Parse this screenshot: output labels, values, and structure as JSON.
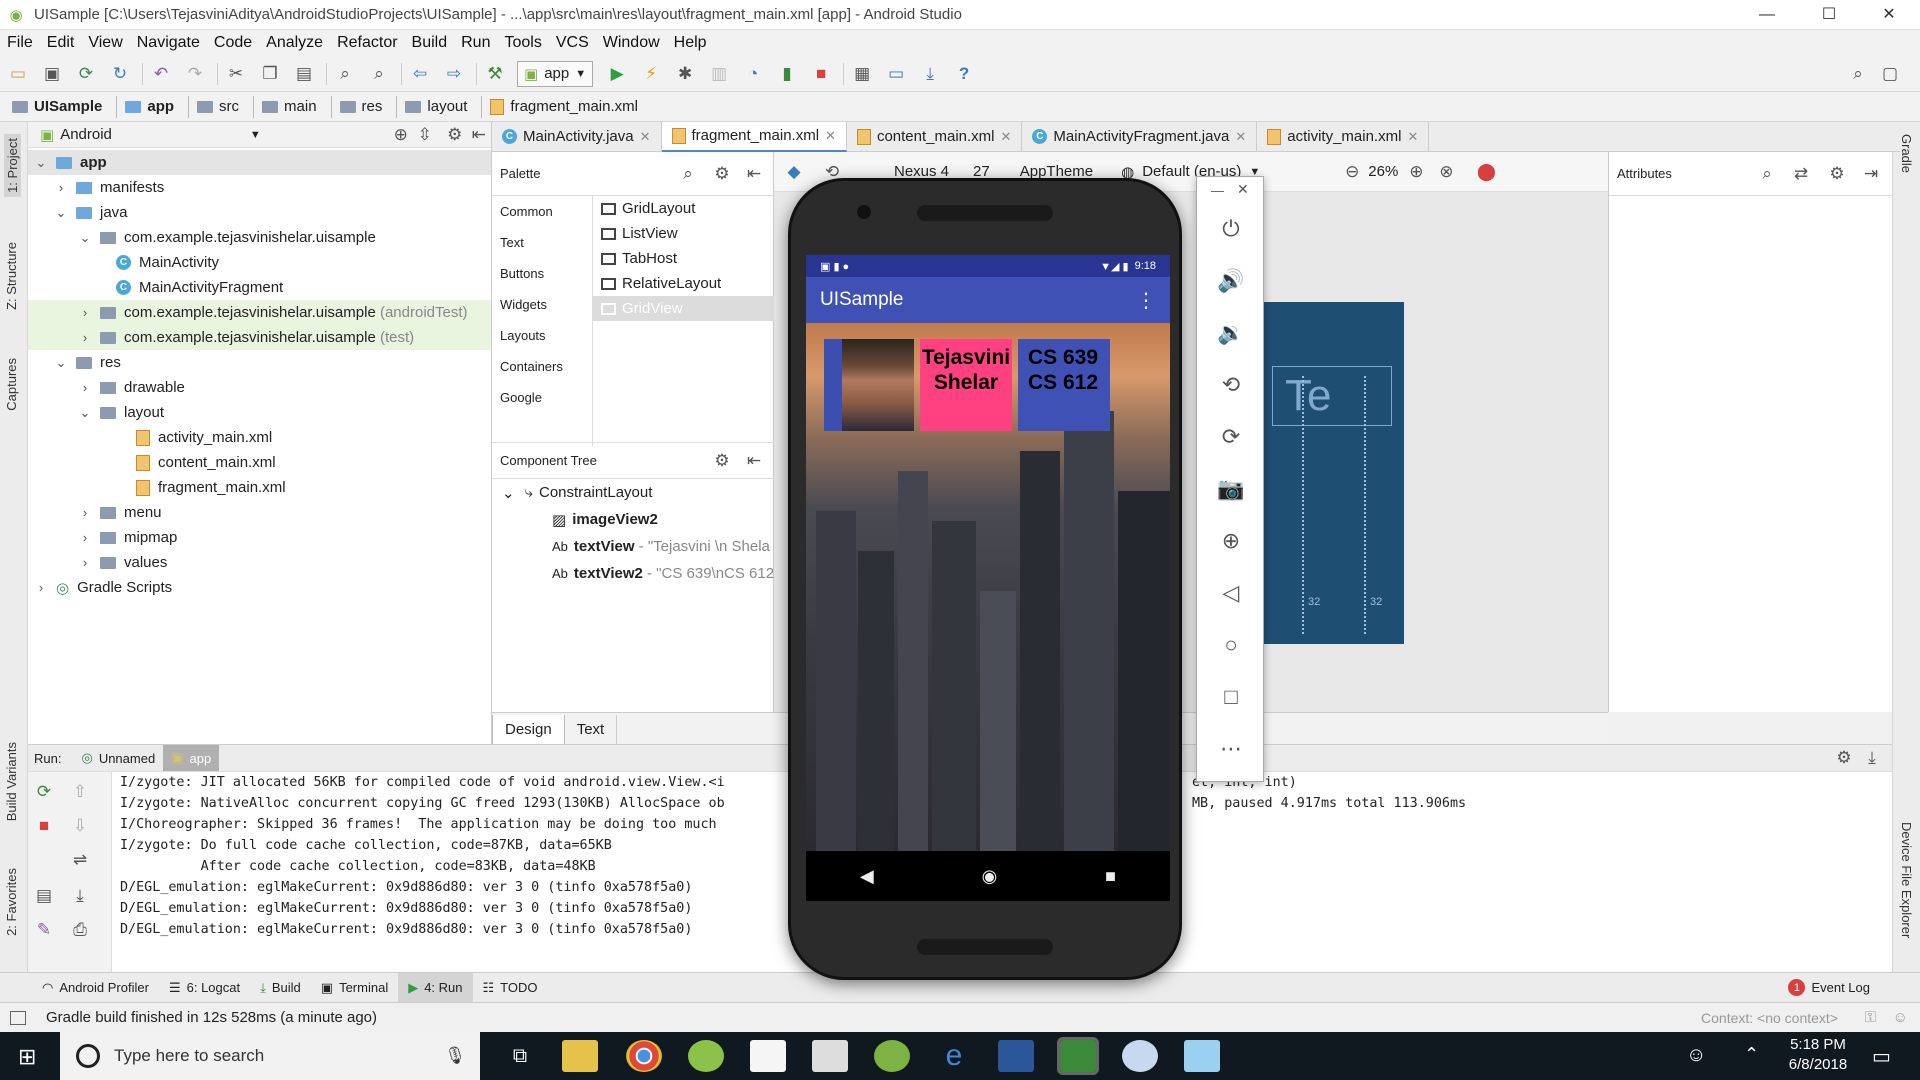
{
  "window": {
    "title": "UISample [C:\\Users\\TejasviniAditya\\AndroidStudioProjects\\UISample] - ...\\app\\src\\main\\res\\layout\\fragment_main.xml [app] - Android Studio",
    "minimize": "—",
    "maximize": "☐",
    "close": "✕"
  },
  "menu": [
    "File",
    "Edit",
    "View",
    "Navigate",
    "Code",
    "Analyze",
    "Refactor",
    "Build",
    "Run",
    "Tools",
    "VCS",
    "Window",
    "Help"
  ],
  "toolbar": {
    "run_config": "app",
    "help": "?"
  },
  "breadcrumb": [
    "UISample",
    "app",
    "src",
    "main",
    "res",
    "layout",
    "fragment_main.xml"
  ],
  "left_strip": {
    "project": "1: Project",
    "structure": "Z: Structure",
    "captures": "Captures",
    "build_variants": "Build Variants",
    "favorites": "2: Favorites"
  },
  "right_strip": {
    "gradle": "Gradle",
    "device_file_explorer": "Device File Explorer"
  },
  "project_panel": {
    "view_mode": "Android",
    "tree": [
      {
        "label": "app",
        "bold": true
      },
      {
        "label": "manifests"
      },
      {
        "label": "java"
      },
      {
        "label": "com.example.tejasvinishelar.uisample"
      },
      {
        "label": "MainActivity"
      },
      {
        "label": "MainActivityFragment"
      },
      {
        "label": "com.example.tejasvinishelar.uisample",
        "suffix": "(androidTest)"
      },
      {
        "label": "com.example.tejasvinishelar.uisample",
        "suffix": "(test)"
      },
      {
        "label": "res"
      },
      {
        "label": "drawable"
      },
      {
        "label": "layout"
      },
      {
        "label": "activity_main.xml"
      },
      {
        "label": "content_main.xml"
      },
      {
        "label": "fragment_main.xml"
      },
      {
        "label": "menu"
      },
      {
        "label": "mipmap"
      },
      {
        "label": "values"
      },
      {
        "label": "Gradle Scripts"
      }
    ]
  },
  "editor_tabs": [
    {
      "label": "MainActivity.java"
    },
    {
      "label": "fragment_main.xml",
      "active": true
    },
    {
      "label": "content_main.xml"
    },
    {
      "label": "MainActivityFragment.java"
    },
    {
      "label": "activity_main.xml"
    }
  ],
  "palette": {
    "title": "Palette",
    "categories": [
      "Common",
      "Text",
      "Buttons",
      "Widgets",
      "Layouts",
      "Containers",
      "Google"
    ],
    "items": [
      "GridLayout",
      "ListView",
      "TabHost",
      "RelativeLayout",
      "GridView"
    ]
  },
  "component_tree": {
    "title": "Component Tree",
    "root": "ConstraintLayout",
    "children": [
      {
        "name": "imageView2",
        "detail": ""
      },
      {
        "name": "textView",
        "detail": "- \"Tejasvini \\n Shela"
      },
      {
        "name": "textView2",
        "detail": "- \"CS 639\\nCS 612"
      }
    ]
  },
  "design_toolbar": {
    "device": "Nexus 4",
    "api": "27",
    "theme": "AppTheme",
    "locale": "Default (en-us)",
    "zoom": "26%"
  },
  "blueprint": {
    "label": "Te",
    "margin_left": "32",
    "margin_right": "32"
  },
  "design_tabs": [
    "Design",
    "Text"
  ],
  "attributes": {
    "title": "Attributes"
  },
  "emulator": {
    "time": "9:18",
    "app_title": "UISample",
    "name_line1": "Tejasvini",
    "name_line2": "Shelar",
    "course1": "CS 639",
    "course2": "CS 612"
  },
  "run": {
    "label": "Run:",
    "tabs": [
      "Unnamed",
      "app"
    ],
    "console": [
      "I/zygote: JIT allocated 56KB for compiled code of void android.view.View.<i",
      "I/zygote: NativeAlloc concurrent copying GC freed 1293(130KB) AllocSpace ob",
      "I/Choreographer: Skipped 36 frames!  The application may be doing too much",
      "I/zygote: Do full code cache collection, code=87KB, data=65KB",
      "          After code cache collection, code=83KB, data=48KB",
      "D/EGL_emulation: eglMakeCurrent: 0x9d886d80: ver 3 0 (tinfo 0xa578f5a0)",
      "D/EGL_emulation: eglMakeCurrent: 0x9d886d80: ver 3 0 (tinfo 0xa578f5a0)",
      "D/EGL_emulation: eglMakeCurrent: 0x9d886d80: ver 3 0 (tinfo 0xa578f5a0)"
    ],
    "console_tail_1": "et, int, int)",
    "console_tail_2": "MB, paused 4.917ms total 113.906ms"
  },
  "bottom_tools": [
    "Android Profiler",
    "6: Logcat",
    "Build",
    "Terminal",
    "4: Run",
    "TODO"
  ],
  "event_log": {
    "count": "1",
    "label": "Event Log"
  },
  "status": {
    "message": "Gradle build finished in 12s 528ms (a minute ago)",
    "context": "Context: <no context>"
  },
  "taskbar": {
    "search_placeholder": "Type here to search",
    "time": "5:18 PM",
    "date": "6/8/2018"
  }
}
